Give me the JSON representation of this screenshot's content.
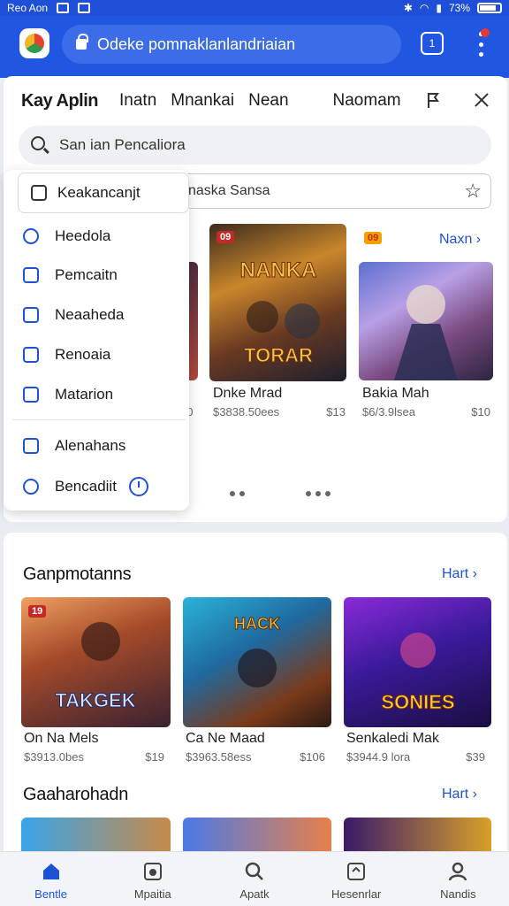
{
  "status_bar": {
    "left_text": "Reo Aon",
    "battery": "73%"
  },
  "browser": {
    "url_text": "Odeke pomnaklanlandriaian",
    "tabs_count": "1"
  },
  "panel": {
    "brand": "Kay Aplin",
    "tabs": [
      "Inatn",
      "Mnankai",
      "Nean",
      "Naomam"
    ],
    "search_placeholder": "San ian Pencaliora",
    "search2_text": "naska Sansa"
  },
  "dropdown": {
    "first_item": "Keakancanjt",
    "items": [
      "Heedola",
      "Pemcaitn",
      "Neaaheda",
      "Renoaia",
      "Matarion"
    ],
    "items_after_divider": [
      "Alenahans",
      "Bencadiit"
    ]
  },
  "featured": {
    "see_all": "Naxn",
    "badges": [
      "09",
      "09"
    ],
    "games": [
      {
        "title": "Dnke Mrad",
        "price_left": "$3838.50ees",
        "price_right": "$13"
      },
      {
        "title": "Bakia Mah",
        "price_left": "$6/3.9lsea",
        "price_right": "$10"
      }
    ],
    "partial_meta": "10"
  },
  "section1": {
    "title": "Ganpmotanns",
    "see_all": "Hart",
    "badge": "19",
    "games": [
      {
        "title": "On Na Mels",
        "price_left": "$3913.0bes",
        "price_right": "$19"
      },
      {
        "title": "Ca Ne Maad",
        "price_left": "$3963.58ess",
        "price_right": "$106"
      },
      {
        "title": "Senkaledi Mak",
        "price_left": "$3944.9 lora",
        "price_right": "$39"
      }
    ]
  },
  "section2": {
    "title": "Gaaharohadn",
    "see_all": "Hart"
  },
  "bottom_nav": [
    "Bentle",
    "Mpaitia",
    "Apatk",
    "Hesenrlar",
    "Nandis"
  ],
  "colors": {
    "brand_blue": "#2156e0",
    "accent": "#1e52d6"
  }
}
